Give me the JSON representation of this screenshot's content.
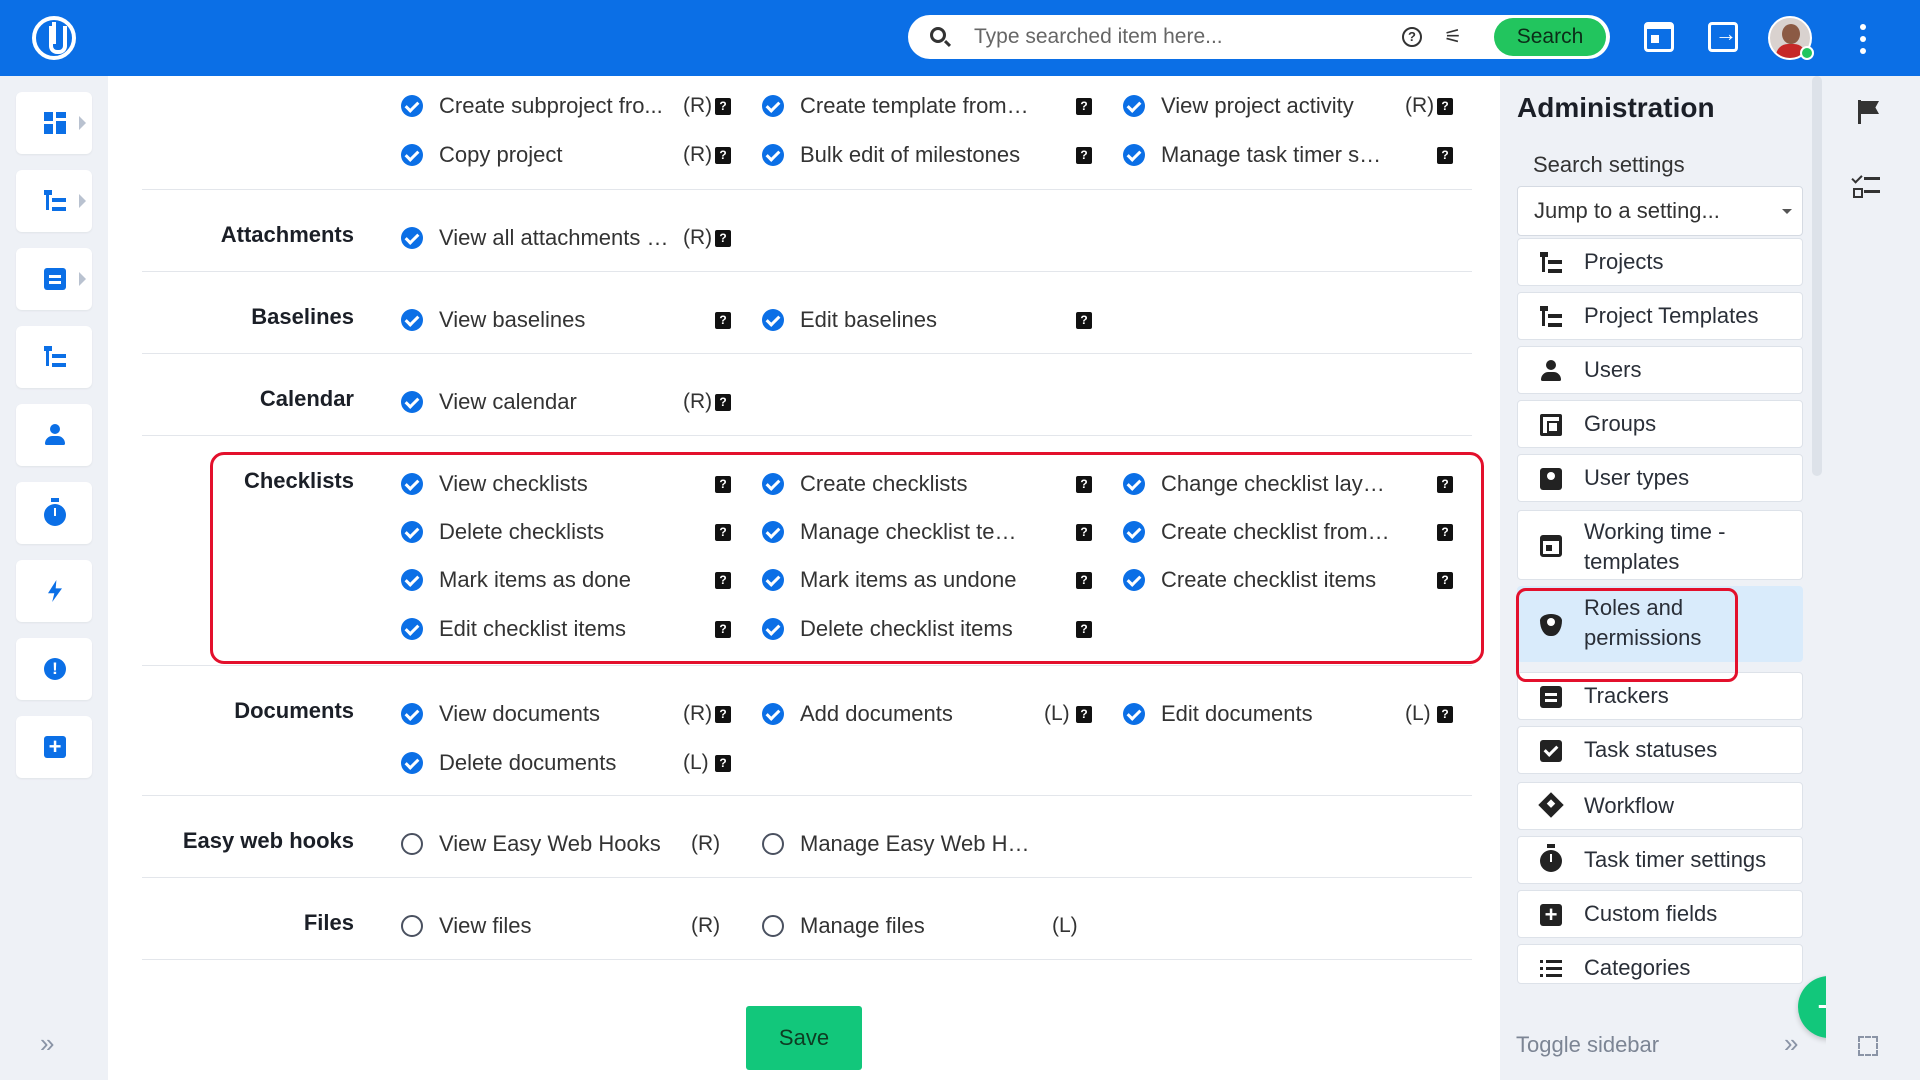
{
  "search": {
    "placeholder": "Type searched item here...",
    "button_label": "Search"
  },
  "rows": [
    {
      "label": "",
      "perms": [
        {
          "label": "Create subproject fro...",
          "tag": "(R)",
          "checked": true,
          "help": true
        },
        {
          "label": "Create template from pro...",
          "tag": "",
          "checked": true,
          "help": true
        },
        {
          "label": "View project activity",
          "tag": "(R)",
          "checked": true,
          "help": true
        },
        {
          "label": "Copy project",
          "tag": "(R)",
          "checked": true,
          "help": true
        },
        {
          "label": "Bulk edit of milestones",
          "tag": "",
          "checked": true,
          "help": true
        },
        {
          "label": "Manage task timer setting...",
          "tag": "",
          "checked": true,
          "help": true
        }
      ]
    },
    {
      "label": "Attachments",
      "perms": [
        {
          "label": "View all attachments o...",
          "tag": "(R)",
          "checked": true,
          "help": true
        }
      ]
    },
    {
      "label": "Baselines",
      "perms": [
        {
          "label": "View baselines",
          "tag": "",
          "checked": true,
          "help": true
        },
        {
          "label": "Edit baselines",
          "tag": "",
          "checked": true,
          "help": true
        }
      ]
    },
    {
      "label": "Calendar",
      "perms": [
        {
          "label": "View calendar",
          "tag": "(R)",
          "checked": true,
          "help": true
        }
      ]
    },
    {
      "label": "Checklists",
      "perms": [
        {
          "label": "View checklists",
          "tag": "",
          "checked": true,
          "help": true
        },
        {
          "label": "Create checklists",
          "tag": "",
          "checked": true,
          "help": true
        },
        {
          "label": "Change checklist layout",
          "tag": "",
          "checked": true,
          "help": true
        },
        {
          "label": "Delete checklists",
          "tag": "",
          "checked": true,
          "help": true
        },
        {
          "label": "Manage checklist templa...",
          "tag": "",
          "checked": true,
          "help": true
        },
        {
          "label": "Create checklist from te...",
          "tag": "",
          "checked": true,
          "help": true
        },
        {
          "label": "Mark items as done",
          "tag": "",
          "checked": true,
          "help": true
        },
        {
          "label": "Mark items as undone",
          "tag": "",
          "checked": true,
          "help": true
        },
        {
          "label": "Create checklist items",
          "tag": "",
          "checked": true,
          "help": true
        },
        {
          "label": "Edit checklist items",
          "tag": "",
          "checked": true,
          "help": true
        },
        {
          "label": "Delete checklist items",
          "tag": "",
          "checked": true,
          "help": true
        }
      ]
    },
    {
      "label": "Documents",
      "perms": [
        {
          "label": "View documents",
          "tag": "(R)",
          "checked": true,
          "help": true
        },
        {
          "label": "Add documents",
          "tag": "(L)",
          "checked": true,
          "help": true
        },
        {
          "label": "Edit documents",
          "tag": "(L)",
          "checked": true,
          "help": true
        },
        {
          "label": "Delete documents",
          "tag": "(L)",
          "checked": true,
          "help": true
        }
      ]
    },
    {
      "label": "Easy web hooks",
      "perms": [
        {
          "label": "View Easy Web Hooks",
          "tag": "(R)",
          "checked": false,
          "help": false
        },
        {
          "label": "Manage Easy Web Hooks",
          "tag": "",
          "checked": false,
          "help": false
        }
      ]
    },
    {
      "label": "Files",
      "perms": [
        {
          "label": "View files",
          "tag": "(R)",
          "checked": false,
          "help": false
        },
        {
          "label": "Manage files",
          "tag": "(L)",
          "checked": false,
          "help": false
        }
      ]
    }
  ],
  "save_label": "Save",
  "admin": {
    "title": "Administration",
    "search_label": "Search settings",
    "jump_placeholder": "Jump to a setting...",
    "items": [
      {
        "label": "Projects",
        "icon": "project-tree-icon"
      },
      {
        "label": "Project Templates",
        "icon": "project-tree-icon"
      },
      {
        "label": "Users",
        "icon": "person-icon"
      },
      {
        "label": "Groups",
        "icon": "group-icon"
      },
      {
        "label": "User types",
        "icon": "badge-icon"
      },
      {
        "label": "Working time - templates",
        "icon": "calendar-icon"
      },
      {
        "label": "Roles and permissions",
        "icon": "shield-icon",
        "active": true
      },
      {
        "label": "Trackers",
        "icon": "clipboard-icon"
      },
      {
        "label": "Task statuses",
        "icon": "check-square-icon"
      },
      {
        "label": "Workflow",
        "icon": "diamond-icon"
      },
      {
        "label": "Task timer settings",
        "icon": "timer-icon"
      },
      {
        "label": "Custom fields",
        "icon": "plus-square-icon"
      },
      {
        "label": "Categories",
        "icon": "list-icon"
      }
    ],
    "toggle_label": "Toggle sidebar"
  },
  "colors": {
    "brand": "#0b6fe6",
    "accent_green": "#12c77b",
    "highlight_red": "#e3102c"
  }
}
